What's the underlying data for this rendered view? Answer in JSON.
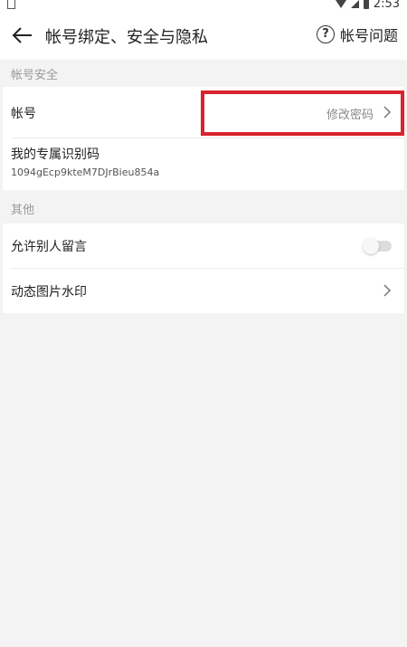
{
  "status_bar": {
    "time": "2:53",
    "icons": [
      "sim-icon",
      "wifi-icon",
      "cell-signal-icon",
      "battery-icon"
    ]
  },
  "header": {
    "title": "帐号绑定、安全与隐私",
    "back_icon": "back-arrow-icon",
    "help_label": "帐号问题",
    "help_icon": "question-circle-icon"
  },
  "sections": {
    "account_security": {
      "label": "帐号安全",
      "account_row": {
        "label": "帐号",
        "value": "修改密码"
      },
      "id_row": {
        "label": "我的专属识别码",
        "value": "1094gEcp9kteM7DJrBieu854a"
      }
    },
    "other": {
      "label": "其他",
      "allow_comments_row": {
        "label": "允许别人留言",
        "toggle_on": false
      },
      "watermark_row": {
        "label": "动态图片水印"
      }
    }
  },
  "colors": {
    "highlight": "#d9232d",
    "background": "#f3f3f3",
    "card": "#ffffff",
    "section_label": "#999999"
  }
}
